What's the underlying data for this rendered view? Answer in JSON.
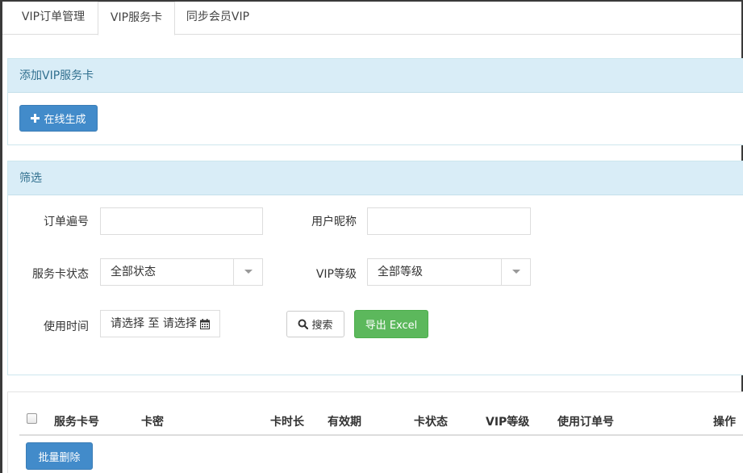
{
  "tabs": [
    {
      "label": "VIP订单管理",
      "active": false
    },
    {
      "label": "VIP服务卡",
      "active": true
    },
    {
      "label": "同步会员VIP",
      "active": false
    }
  ],
  "add_panel": {
    "title": "添加VIP服务卡",
    "generate_button": "在线生成",
    "generate_icon": "plus-icon"
  },
  "filter_panel": {
    "title": "筛选",
    "order_no_label": "订单遍号",
    "order_no_value": "",
    "nickname_label": "用户昵称",
    "nickname_value": "",
    "card_status_label": "服务卡状态",
    "card_status_value": "全部状态",
    "vip_level_label": "VIP等级",
    "vip_level_value": "全部等级",
    "use_time_label": "使用时间",
    "date_range": "请选择 至 请选择",
    "date_icon": "calendar-icon",
    "search_button": "搜索",
    "search_icon": "search-icon",
    "export_button": "导出 Excel"
  },
  "table": {
    "headers": [
      "服务卡号",
      "卡密",
      "卡时长",
      "有效期",
      "卡状态",
      "VIP等级",
      "使用订单号",
      "操作"
    ],
    "batch_delete_button": "批量删除"
  },
  "colors": {
    "panel_header_bg": "#d9edf7",
    "panel_header_text": "#31708f",
    "primary": "#428bca",
    "success": "#5cb85c"
  }
}
